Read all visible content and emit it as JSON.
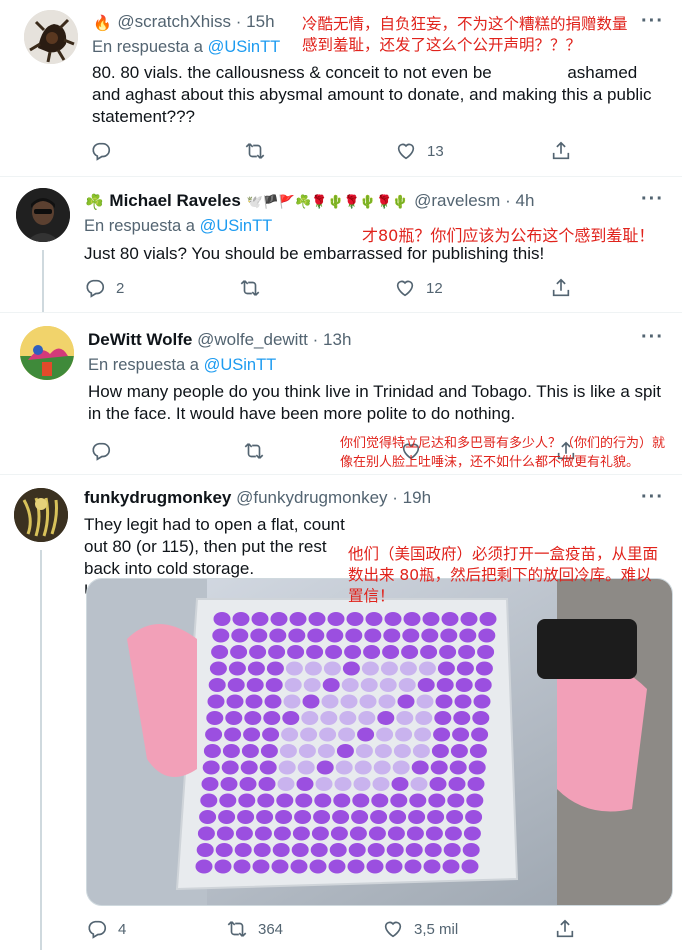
{
  "tweets": [
    {
      "name": "",
      "name_emoji": "🔥",
      "handle": "@scratchXhiss",
      "time": "15h",
      "reply_prefix": "En respuesta a",
      "reply_to": "@USinTT",
      "text": "80. 80 vials. the callousness & conceit to not even be                ashamed and aghast about this abysmal amount to donate, and making this a public statement???",
      "translation": "冷酷无情，自负狂妄，不为这个糟糕的捐赠数量感到羞耻，还发了这么个公开声明？？？",
      "replies": "",
      "retweets": "",
      "likes": "13"
    },
    {
      "name": "Michael Raveles",
      "name_prefix_emoji": "☘️",
      "name_emojis": "🕊️🏴🚩☘️🌹🌵🌹🌵🌹🌵",
      "handle": "@ravelesm",
      "time": "4h",
      "reply_prefix": "En respuesta a",
      "reply_to": "@USinTT",
      "text": "Just 80 vials? You should be embarrassed for publishing this!",
      "translation": "才80瓶？你们应该为公布这个感到羞耻！",
      "replies": "2",
      "retweets": "",
      "likes": "12"
    },
    {
      "name": "DeWitt Wolfe",
      "handle": "@wolfe_dewitt",
      "time": "13h",
      "reply_prefix": "En respuesta a",
      "reply_to": "@USinTT",
      "text": "How many people do you think live in Trinidad and Tobago. This is like a spit in the face. It would have been more polite to do nothing.",
      "translation": "你们觉得特立尼达和多巴哥有多少人？（你们的行为）就像在别人脸上吐唾沫，还不如什么都不做更有礼貌。",
      "replies": "",
      "retweets": "",
      "likes": ""
    },
    {
      "name": "funkydrugmonkey",
      "handle": "@funkydrugmonkey",
      "time": "19h",
      "text": "They legit had to open a flat, count out 80 (or 115), then put the rest back into cold storage. Unbelievable",
      "translation": "他们（美国政府）必须打开一盒疫苗，从里面数出来 80瓶，然后把剩下的放回冷库。难以置信！",
      "replies": "4",
      "retweets": "364",
      "likes": "3,5 mil"
    }
  ],
  "more_label": "···",
  "colors": {
    "link": "#1d9bf0",
    "muted": "#536471",
    "annotation": "#e0231c",
    "vial_cap": "#9b4fe0"
  }
}
